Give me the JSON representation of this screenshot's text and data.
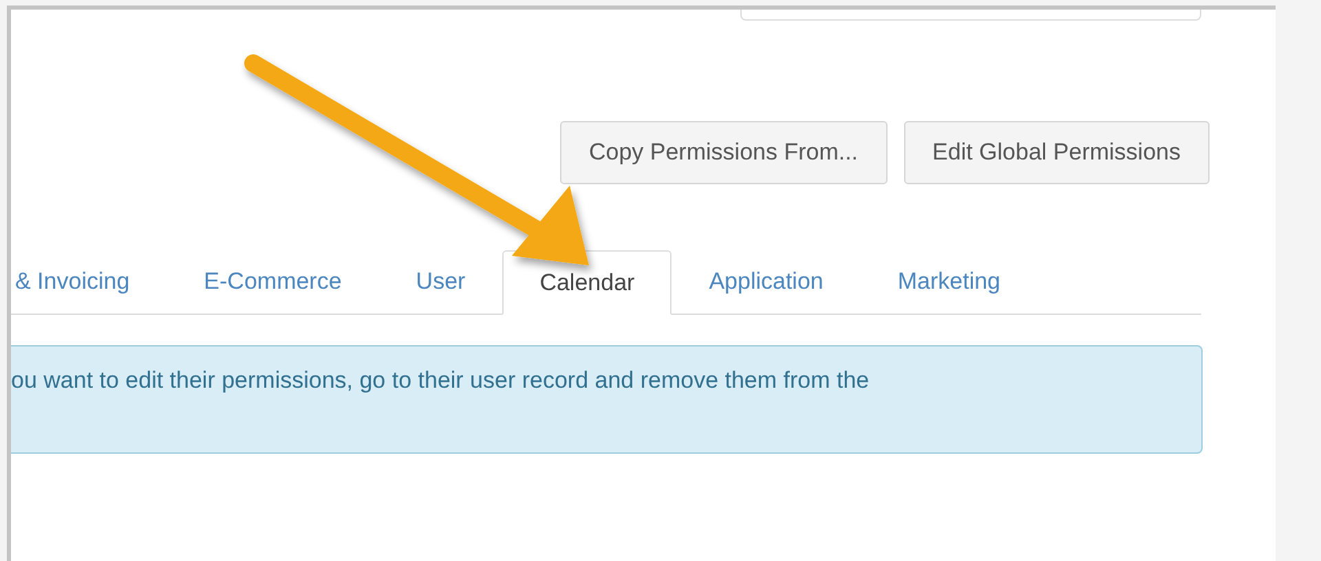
{
  "buttons": [
    {
      "label": "Copy Permissions From..."
    },
    {
      "label": "Edit Global Permissions"
    }
  ],
  "tabs": [
    {
      "label": "& Invoicing",
      "selected": false
    },
    {
      "label": "E-Commerce",
      "selected": false
    },
    {
      "label": "User",
      "selected": false
    },
    {
      "label": "Calendar",
      "selected": true
    },
    {
      "label": "Application",
      "selected": false
    },
    {
      "label": "Marketing",
      "selected": false
    }
  ],
  "alert": {
    "text": "ou want to edit their permissions, go to their user record and remove them from the"
  }
}
